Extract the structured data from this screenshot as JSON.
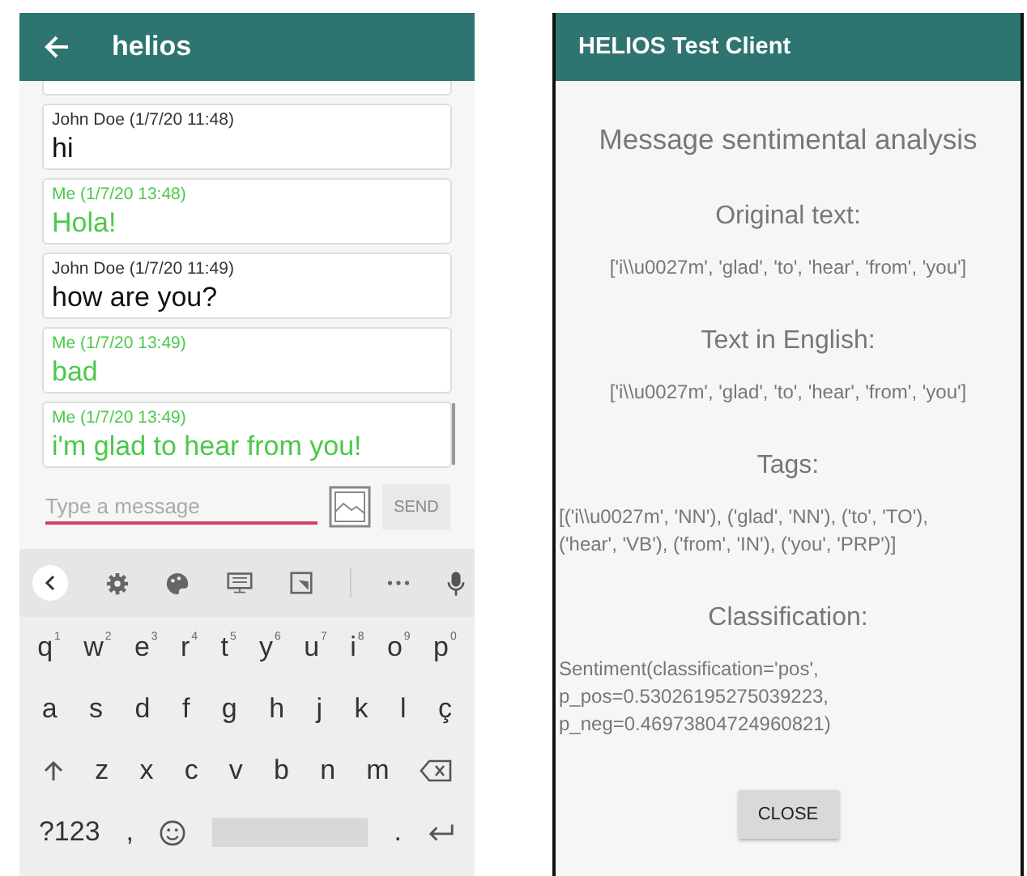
{
  "chat": {
    "title": "helios",
    "messages": [
      {
        "header": "John Doe (1/7/20 11:48)",
        "text": "hi",
        "mine": false
      },
      {
        "header": "Me (1/7/20 13:48)",
        "text": "Hola!",
        "mine": true
      },
      {
        "header": "John Doe (1/7/20 11:49)",
        "text": "how are you?",
        "mine": false
      },
      {
        "header": "Me (1/7/20 13:49)",
        "text": "bad",
        "mine": true
      },
      {
        "header": "Me (1/7/20 13:49)",
        "text": "i'm glad to hear from you!",
        "mine": true
      }
    ],
    "input": {
      "placeholder": "Type a message"
    },
    "send_button": "SEND"
  },
  "keyboard": {
    "rows": [
      [
        {
          "kind": "char",
          "label": "q",
          "hint": "1"
        },
        {
          "kind": "char",
          "label": "w",
          "hint": "2"
        },
        {
          "kind": "char",
          "label": "e",
          "hint": "3"
        },
        {
          "kind": "char",
          "label": "r",
          "hint": "4"
        },
        {
          "kind": "char",
          "label": "t",
          "hint": "5"
        },
        {
          "kind": "char",
          "label": "y",
          "hint": "6"
        },
        {
          "kind": "char",
          "label": "u",
          "hint": "7"
        },
        {
          "kind": "char",
          "label": "i",
          "hint": "8"
        },
        {
          "kind": "char",
          "label": "o",
          "hint": "9"
        },
        {
          "kind": "char",
          "label": "p",
          "hint": "0"
        }
      ],
      [
        {
          "kind": "char",
          "label": "a"
        },
        {
          "kind": "char",
          "label": "s"
        },
        {
          "kind": "char",
          "label": "d"
        },
        {
          "kind": "char",
          "label": "f"
        },
        {
          "kind": "char",
          "label": "g"
        },
        {
          "kind": "char",
          "label": "h"
        },
        {
          "kind": "char",
          "label": "j"
        },
        {
          "kind": "char",
          "label": "k"
        },
        {
          "kind": "char",
          "label": "l"
        },
        {
          "kind": "char",
          "label": "ç"
        }
      ],
      [
        {
          "kind": "shift"
        },
        {
          "kind": "char",
          "label": "z"
        },
        {
          "kind": "char",
          "label": "x"
        },
        {
          "kind": "char",
          "label": "c"
        },
        {
          "kind": "char",
          "label": "v"
        },
        {
          "kind": "char",
          "label": "b"
        },
        {
          "kind": "char",
          "label": "n"
        },
        {
          "kind": "char",
          "label": "m"
        },
        {
          "kind": "backspace"
        }
      ],
      [
        {
          "kind": "char",
          "label": "?123"
        },
        {
          "kind": "char",
          "label": ","
        },
        {
          "kind": "emoji"
        },
        {
          "kind": "space"
        },
        {
          "kind": "char",
          "label": "."
        },
        {
          "kind": "enter"
        }
      ]
    ]
  },
  "dialog": {
    "title": "HELIOS Test Client",
    "heading": "Message sentimental analysis",
    "sections": [
      {
        "heading": "Original text:",
        "lines": [
          "['i\\\\u0027m', 'glad', 'to', 'hear', 'from', 'you']"
        ]
      },
      {
        "heading": "Text in English:",
        "lines": [
          "['i\\\\u0027m', 'glad', 'to', 'hear', 'from', 'you']"
        ]
      },
      {
        "heading": "Tags:",
        "lines": [
          "[('i\\\\u0027m', 'NN'), ('glad', 'NN'), ('to', 'TO'),",
          "('hear', 'VB'), ('from', 'IN'), ('you', 'PRP')]"
        ]
      },
      {
        "heading": "Classification:",
        "lines": [
          "Sentiment(classification='pos',",
          "p_pos=0.53026195275039223,",
          "p_neg=0.46973804724960821)"
        ]
      }
    ],
    "close_button": "CLOSE"
  }
}
